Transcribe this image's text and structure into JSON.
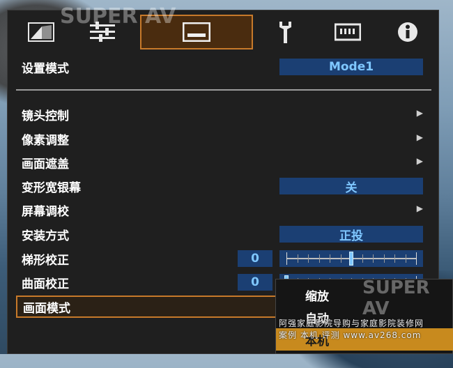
{
  "tabs": [
    {
      "icon": "picture-icon"
    },
    {
      "icon": "sliders-icon"
    },
    {
      "icon": "screen-icon",
      "active": true
    },
    {
      "icon": "wrench-icon"
    },
    {
      "icon": "chip-icon"
    },
    {
      "icon": "info-icon"
    }
  ],
  "menu": {
    "setup_mode": {
      "label": "设置模式",
      "value": "Mode1"
    },
    "lens_control": {
      "label": "镜头控制"
    },
    "pixel_adjust": {
      "label": "像素调整"
    },
    "screen_mask": {
      "label": "画面遮盖"
    },
    "anamorphic": {
      "label": "变形宽银幕",
      "value": "关"
    },
    "screen_adjust": {
      "label": "屏幕调校"
    },
    "install_style": {
      "label": "安装方式",
      "value": "正投"
    },
    "keystone": {
      "label": "梯形校正",
      "value": "0",
      "level": 0.5
    },
    "curved": {
      "label": "曲面校正",
      "value": "0",
      "level": 0
    },
    "picture_mode": {
      "label": "画面模式"
    }
  },
  "popup": {
    "options": [
      "缩放",
      "自动",
      "本机"
    ],
    "selected_index": 2
  },
  "watermark": {
    "brand_left": "SUPER AV",
    "brand_right": "SUPER AV",
    "credit_line1": "阿强家庭影院导购与家庭影院装修网",
    "credit_line2": "案例 本机 评测  www.av268.com"
  },
  "colors": {
    "accent": "#c87a2a",
    "value_bg": "#1b3f73",
    "value_text": "#7fc7ff",
    "popup_active": "#c88a1e"
  }
}
